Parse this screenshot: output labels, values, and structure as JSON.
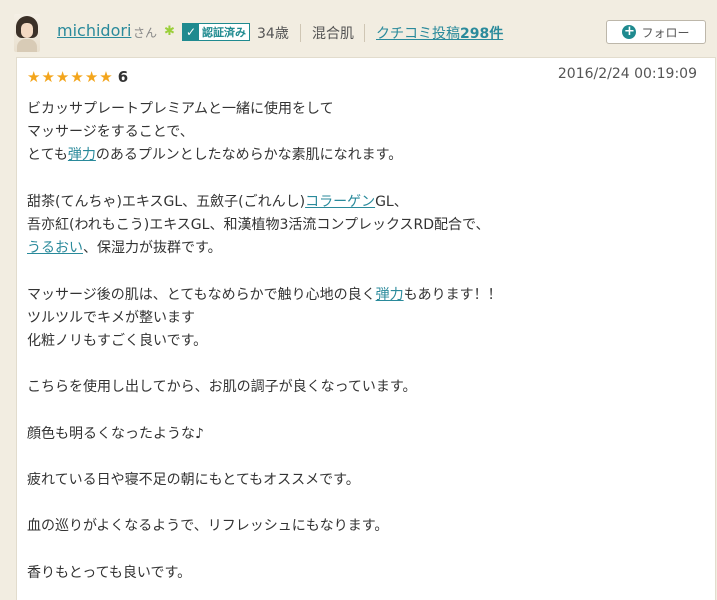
{
  "user": {
    "name": "michidori",
    "honorific": "さん",
    "verified_label": "認証済み",
    "age": "34歳",
    "skin_type": "混合肌",
    "reviews_prefix": "クチコミ投稿",
    "reviews_count": "298件"
  },
  "follow_label": "フォロー",
  "rating": "6",
  "date": "2016/2/24 00:19:09",
  "review_lines": [
    [
      {
        "t": "ビカッサプレートプレミアムと一緒に使用をして"
      }
    ],
    [
      {
        "t": "マッサージをすることで、"
      }
    ],
    [
      {
        "t": "とても"
      },
      {
        "t": "弾力",
        "link": true
      },
      {
        "t": "のあるプルンとしたなめらかな素肌になれます。"
      }
    ],
    [],
    [
      {
        "t": "甜茶(てんちゃ)エキスGL、五斂子(ごれんし)"
      },
      {
        "t": "コラーゲン",
        "link": true
      },
      {
        "t": "GL、"
      }
    ],
    [
      {
        "t": "吾亦紅(われもこう)エキスGL、和漢植物3活流コンプレックスRD配合で、"
      }
    ],
    [
      {
        "t": "うるおい",
        "link": true
      },
      {
        "t": "、保湿力が抜群です。"
      }
    ],
    [],
    [
      {
        "t": "マッサージ後の肌は、とてもなめらかで触り心地の良く"
      },
      {
        "t": "弾力",
        "link": true
      },
      {
        "t": "もあります！！"
      }
    ],
    [
      {
        "t": "ツルツルでキメが整います"
      }
    ],
    [
      {
        "t": "化粧ノリもすごく良いです。"
      }
    ],
    [],
    [
      {
        "t": "こちらを使用し出してから、お肌の調子が良くなっています。"
      }
    ],
    [],
    [
      {
        "t": "顔色も明るくなったような♪"
      }
    ],
    [],
    [
      {
        "t": "疲れている日や寝不足の朝にもとてもオススメです。"
      }
    ],
    [],
    [
      {
        "t": "血の巡りがよくなるようで、リフレッシュにもなります。"
      }
    ],
    [],
    [
      {
        "t": "香りもとっても良いです。"
      }
    ]
  ],
  "colors": {
    "accent": "#2a8a9b",
    "verified": "#1f8a8f",
    "star": "#f3a51c",
    "background": "#f2ede1"
  },
  "icons": {
    "verified": "check-icon",
    "follow": "plus-circle-icon",
    "star": "star-icon",
    "flower": "flower-icon"
  }
}
